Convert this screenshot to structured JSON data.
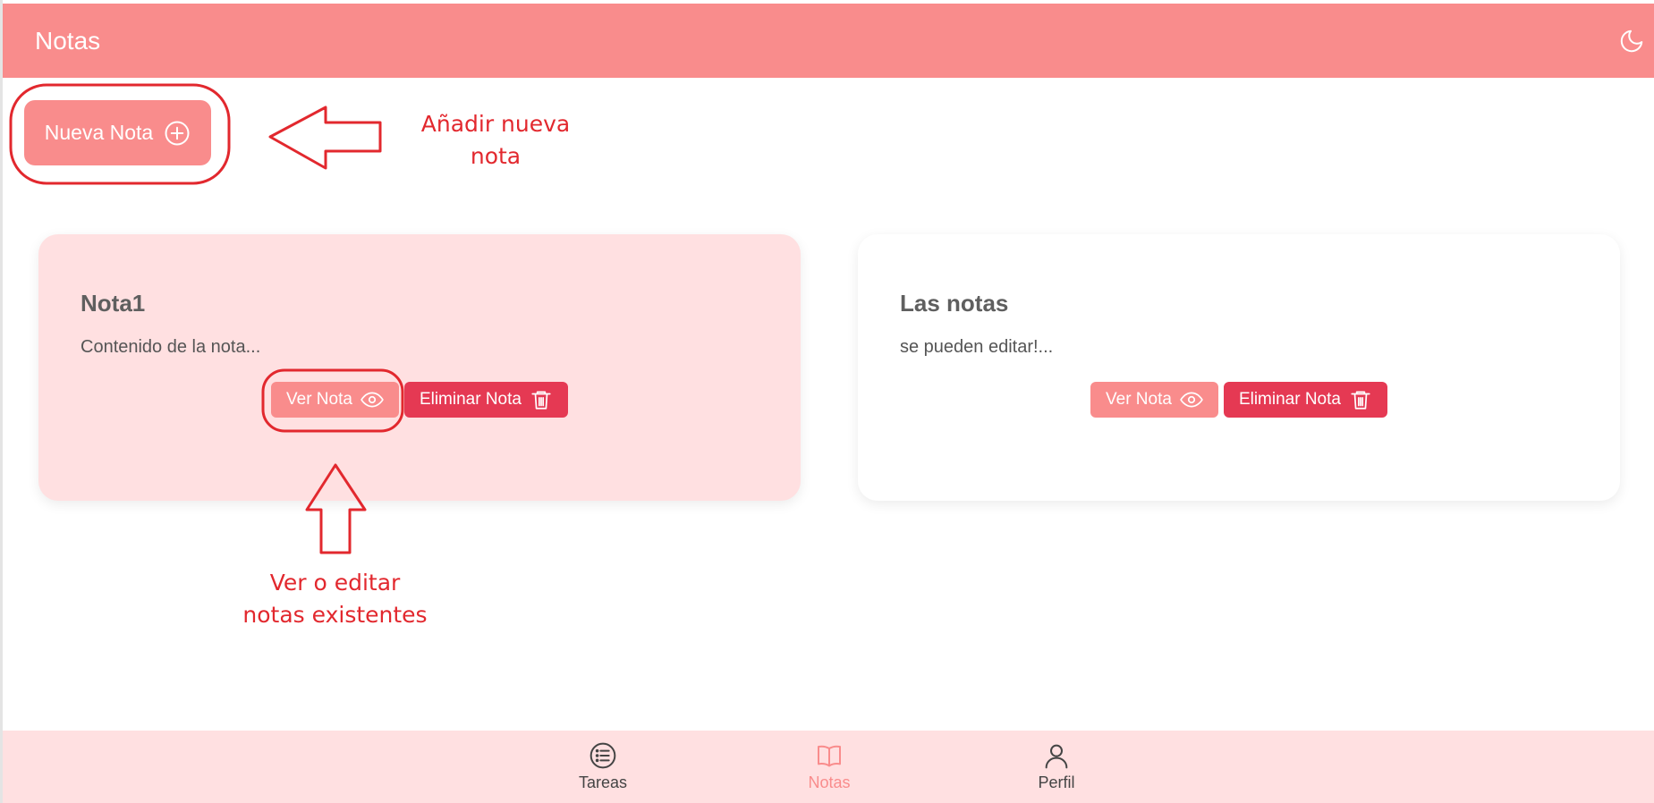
{
  "header": {
    "title": "Notas",
    "theme_icon": "moon-icon"
  },
  "new_note_button": {
    "label": "Nueva Nota",
    "icon": "plus-circle-icon"
  },
  "notes": [
    {
      "title": "Nota1",
      "content": "Contenido de la nota...",
      "view_label": "Ver Nota",
      "delete_label": "Eliminar Nota",
      "selected": true
    },
    {
      "title": "Las notas",
      "content": "se pueden editar!...",
      "view_label": "Ver Nota",
      "delete_label": "Eliminar Nota",
      "selected": false
    }
  ],
  "annotations": {
    "add_note_line1": "Añadir nueva",
    "add_note_line2": "nota",
    "view_edit_line1": "Ver o editar",
    "view_edit_line2": "notas existentes"
  },
  "bottom_nav": {
    "items": [
      {
        "label": "Tareas",
        "icon": "list-icon",
        "active": false
      },
      {
        "label": "Notas",
        "icon": "book-icon",
        "active": true
      },
      {
        "label": "Perfil",
        "icon": "user-icon",
        "active": false
      }
    ]
  },
  "colors": {
    "primary": "#f98c8c",
    "danger": "#e53953",
    "card_selected": "#ffe0e1",
    "nav_background": "#ffe0e1",
    "annotation": "#e2282e"
  }
}
